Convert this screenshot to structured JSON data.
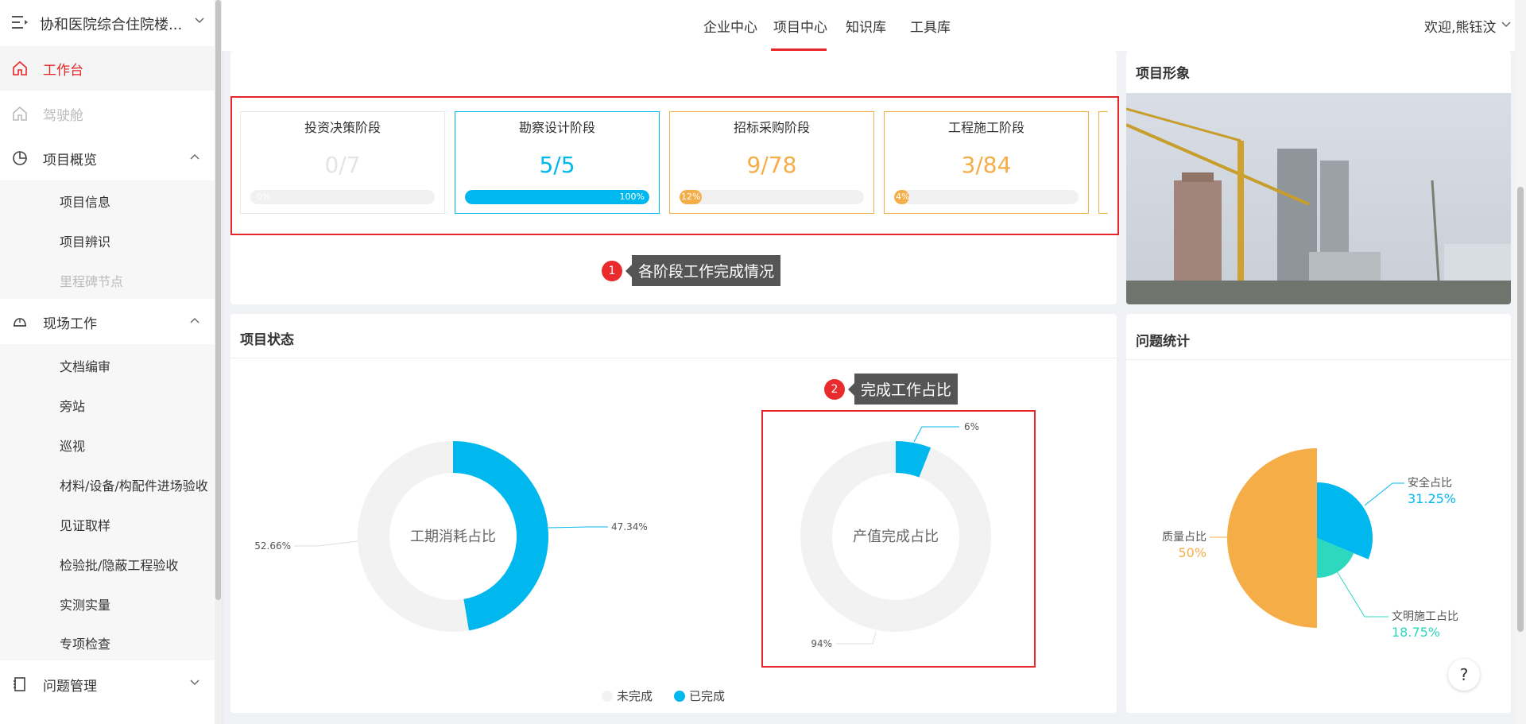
{
  "sidebar": {
    "project_name": "协和医院综合住院楼...",
    "items": [
      {
        "label": "工作台",
        "active": true
      },
      {
        "label": "驾驶舱",
        "disabled": true
      },
      {
        "label": "项目概览"
      },
      {
        "label": "现场工作"
      },
      {
        "label": "问题管理"
      }
    ],
    "overview_sub": [
      "项目信息",
      "项目辨识",
      "里程碑节点"
    ],
    "field_sub": [
      "文档编审",
      "旁站",
      "巡视",
      "材料/设备/构配件进场验收",
      "见证取样",
      "检验批/隐蔽工程验收",
      "实测实量",
      "专项检查"
    ]
  },
  "topnav": {
    "tabs": [
      "企业中心",
      "项目中心",
      "知识库",
      "工具库"
    ],
    "active_tab": "项目中心",
    "user": "欢迎,熊钰汶"
  },
  "stages": [
    {
      "name": "投资决策阶段",
      "value": "0/7",
      "percent_label": "0%",
      "fraction": 0.0,
      "color": "#e8e8e8"
    },
    {
      "name": "勘察设计阶段",
      "value": "5/5",
      "percent_label": "100%",
      "fraction": 1.0,
      "color": "#00b7ee"
    },
    {
      "name": "招标采购阶段",
      "value": "9/78",
      "percent_label": "12%",
      "fraction": 0.12,
      "color": "#f5ad48"
    },
    {
      "name": "工程施工阶段",
      "value": "3/84",
      "percent_label": "4%",
      "fraction": 0.04,
      "color": "#f5ad48"
    }
  ],
  "callouts": {
    "one": {
      "num": "1",
      "text": "各阶段工作完成情况"
    },
    "two": {
      "num": "2",
      "text": "完成工作占比"
    }
  },
  "project_image": {
    "title": "项目形象"
  },
  "project_status": {
    "title": "项目状态"
  },
  "issue_stats": {
    "title": "问题统计"
  },
  "help_label": "?",
  "chart_data": [
    {
      "type": "pie",
      "title": "工期消耗占比",
      "slices": [
        {
          "name": "未完成",
          "value": 52.66,
          "label": "52.66%",
          "color": "#f2f2f2"
        },
        {
          "name": "已完成",
          "value": 47.34,
          "label": "47.34%",
          "color": "#00b7ee"
        }
      ]
    },
    {
      "type": "pie",
      "title": "产值完成占比",
      "slices": [
        {
          "name": "未完成",
          "value": 94,
          "label": "94%",
          "color": "#f2f2f2"
        },
        {
          "name": "已完成",
          "value": 6,
          "label": "6%",
          "color": "#00b7ee"
        }
      ],
      "legend": [
        {
          "name": "未完成",
          "color": "#f2f2f2"
        },
        {
          "name": "已完成",
          "color": "#00b7ee"
        }
      ]
    },
    {
      "type": "pie",
      "slices": [
        {
          "name": "安全占比",
          "value": 31.25,
          "label": "31.25%",
          "color": "#00b7ee"
        },
        {
          "name": "文明施工占比",
          "value": 18.75,
          "label": "18.75%",
          "color": "#2ed8bf"
        },
        {
          "name": "质量占比",
          "value": 50,
          "label": "50%",
          "color": "#f5ad48"
        }
      ]
    }
  ]
}
